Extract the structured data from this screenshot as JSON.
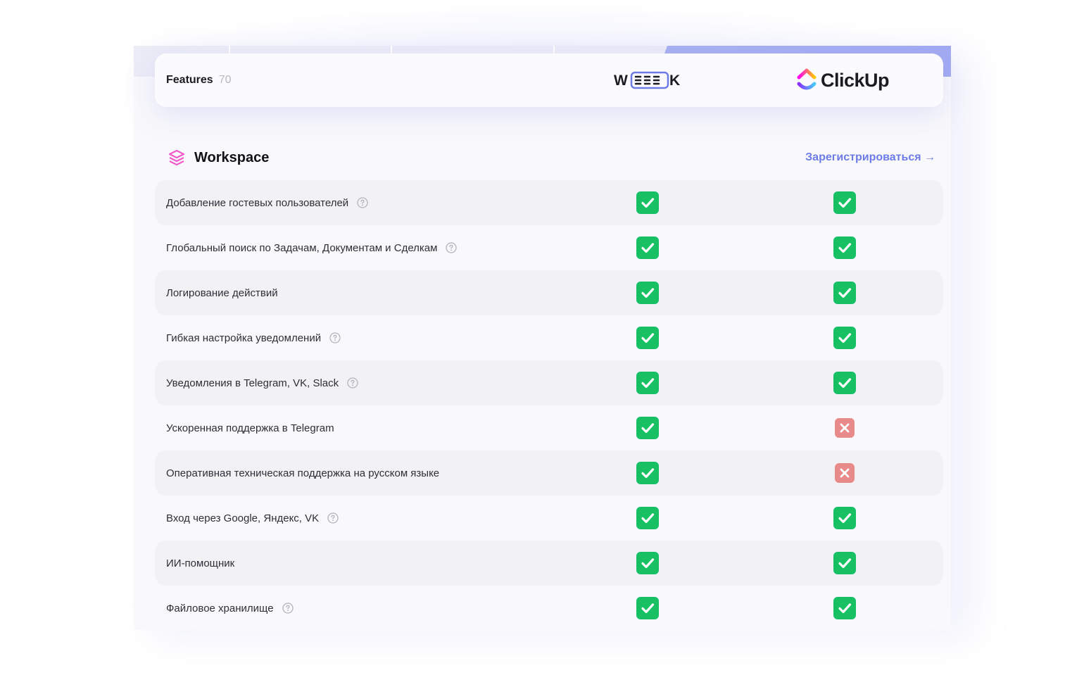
{
  "header": {
    "features_label": "Features",
    "features_count": "70",
    "brands": [
      {
        "name": "WEEEK"
      },
      {
        "name": "ClickUp"
      }
    ]
  },
  "section": {
    "title": "Workspace",
    "icon": "layers-icon",
    "signup_label": "Зарегистрироваться →"
  },
  "colors": {
    "check": "#17c163",
    "cross": "#e88a8a",
    "link": "#6c7be6",
    "accent_strip": "#a9b1f2"
  },
  "rows": [
    {
      "label": "Добавление гостевых пользователей",
      "help": true,
      "weeek": "yes",
      "clickup": "yes"
    },
    {
      "label": "Глобальный поиск по Задачам, Документам и Сделкам",
      "help": true,
      "weeek": "yes",
      "clickup": "yes"
    },
    {
      "label": "Логирование действий",
      "help": false,
      "weeek": "yes",
      "clickup": "yes"
    },
    {
      "label": "Гибкая настройка уведомлений",
      "help": true,
      "weeek": "yes",
      "clickup": "yes"
    },
    {
      "label": "Уведомления в Telegram, VK, Slack",
      "help": true,
      "weeek": "yes",
      "clickup": "yes"
    },
    {
      "label": "Ускоренная поддержка в Telegram",
      "help": false,
      "weeek": "yes",
      "clickup": "no"
    },
    {
      "label": "Оперативная техническая поддержка на русском языке",
      "help": false,
      "weeek": "yes",
      "clickup": "no"
    },
    {
      "label": "Вход через Google, Яндекс, VK",
      "help": true,
      "weeek": "yes",
      "clickup": "yes"
    },
    {
      "label": "ИИ-помощник",
      "help": false,
      "weeek": "yes",
      "clickup": "yes"
    },
    {
      "label": "Файловое хранилище",
      "help": true,
      "weeek": "yes",
      "clickup": "yes"
    }
  ]
}
